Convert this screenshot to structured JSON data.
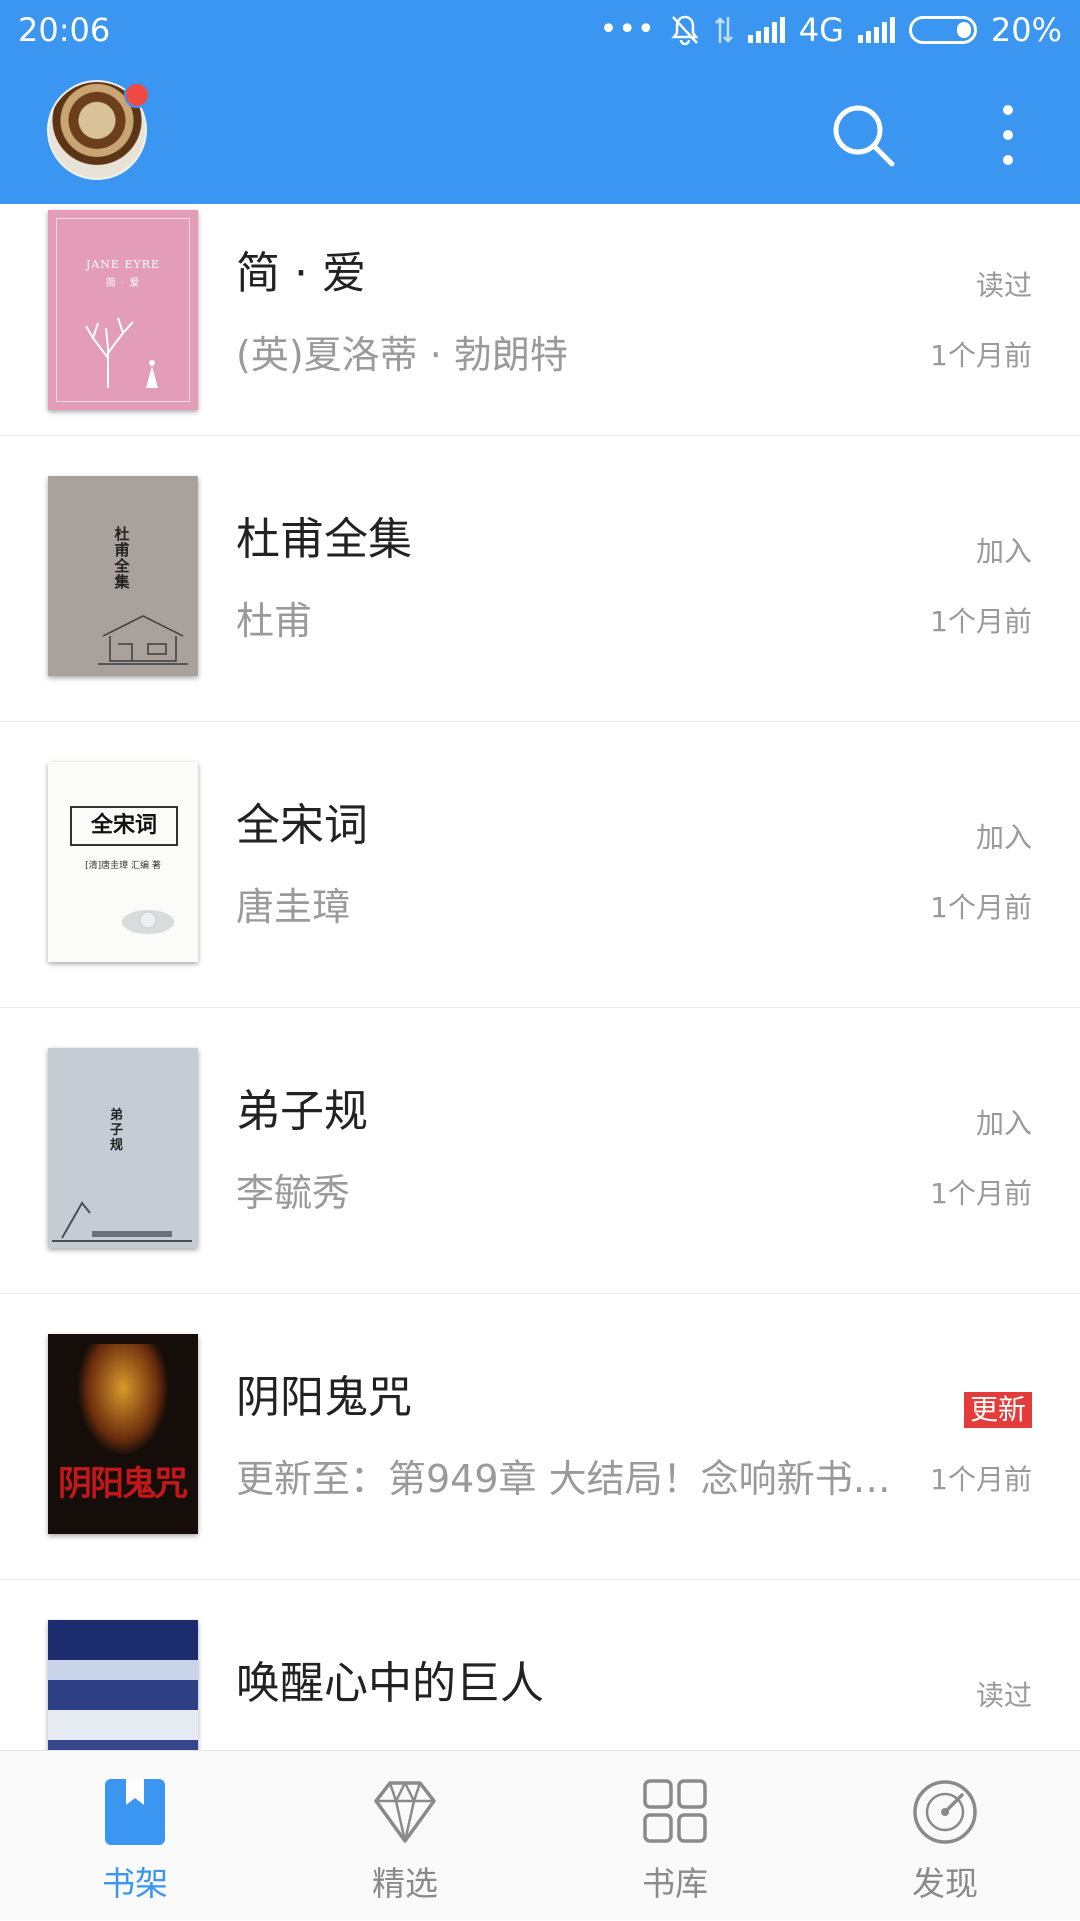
{
  "status_bar": {
    "time": "20:06",
    "dots": "•••",
    "network": "4G",
    "battery_percent": "20%"
  },
  "app_bar": {
    "avatar_notification": true,
    "accent_color": "#3a96f0"
  },
  "books": [
    {
      "title": "简 · 爱",
      "subtitle": "(英)夏洛蒂 · 勃朗特",
      "status": "读过",
      "time": "1个月前",
      "cover_text": "JANE EYRE",
      "cover_subtext": "简 · 爱"
    },
    {
      "title": "杜甫全集",
      "subtitle": "杜甫",
      "status": "加入",
      "time": "1个月前",
      "cover_text": "杜甫全集"
    },
    {
      "title": "全宋词",
      "subtitle": "唐圭璋",
      "status": "加入",
      "time": "1个月前",
      "cover_text": "全宋词",
      "cover_subtext": "[清]唐圭璋 汇编 著"
    },
    {
      "title": "弟子规",
      "subtitle": "李毓秀",
      "status": "加入",
      "time": "1个月前",
      "cover_text": "弟子规"
    },
    {
      "title": "阴阳鬼咒",
      "subtitle": "更新至：第949章 大结局！念响新书…",
      "status": "更新",
      "status_is_badge": true,
      "time": "1个月前",
      "cover_text": "阴阳鬼咒"
    },
    {
      "title": "唤醒心中的巨人",
      "subtitle": "",
      "status": "读过",
      "time": ""
    }
  ],
  "bottom_nav": [
    {
      "label": "书架",
      "icon": "bookshelf-icon",
      "active": true
    },
    {
      "label": "精选",
      "icon": "diamond-icon",
      "active": false
    },
    {
      "label": "书库",
      "icon": "grid-icon",
      "active": false
    },
    {
      "label": "发现",
      "icon": "discover-icon",
      "active": false
    }
  ],
  "colors": {
    "accent": "#3a96f0",
    "badge": "#e43b3b",
    "muted_text": "#9a9a9a"
  }
}
